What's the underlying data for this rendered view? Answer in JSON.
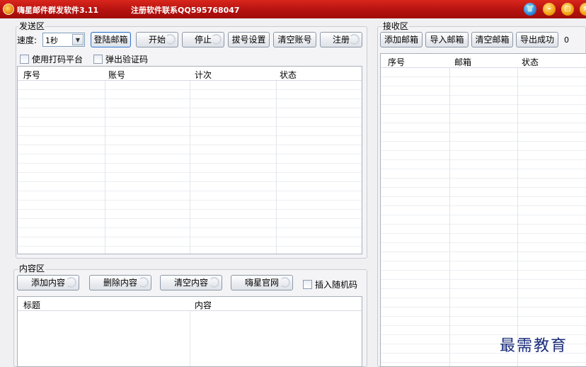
{
  "window": {
    "title": "嗨星邮件群发软件3.11",
    "contact": "注册软件联系QQ595768047"
  },
  "send_area": {
    "label": "发送区",
    "speed_label": "速度:",
    "speed_value": "1秒",
    "buttons": {
      "login": "登陆邮箱",
      "start": "开始",
      "stop": "停止",
      "dial": "拔号设置",
      "clear_accounts": "清空账号",
      "register": "注册"
    },
    "checkboxes": {
      "use_platform": "使用打码平台",
      "popup_captcha": "弹出验证码"
    },
    "columns": [
      "序号",
      "账号",
      "计次",
      "状态"
    ]
  },
  "content_area": {
    "label": "内容区",
    "buttons": {
      "add": "添加内容",
      "delete": "删除内容",
      "clear": "清空内容",
      "official": "嗨星官网"
    },
    "checkbox_random": "插入随机码",
    "columns": [
      "标题",
      "内容"
    ]
  },
  "receive_area": {
    "label": "接收区",
    "buttons": {
      "add": "添加邮箱",
      "import": "导入邮箱",
      "clear": "清空邮箱",
      "export_success": "导出成功"
    },
    "count": "0",
    "columns": [
      "序号",
      "邮箱",
      "状态"
    ]
  },
  "watermark": "最需教育"
}
